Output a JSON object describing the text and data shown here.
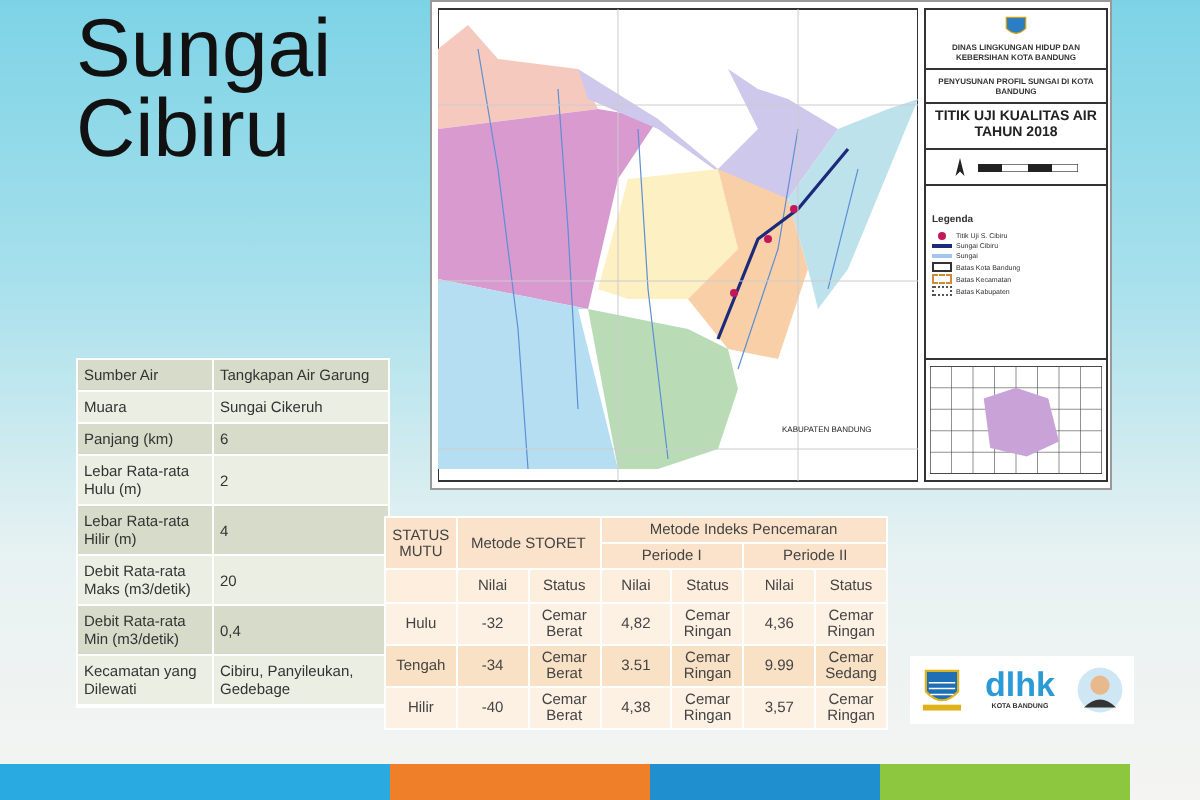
{
  "title": "Sungai Cibiru",
  "profile_table": [
    {
      "label": "Sumber Air",
      "value": "Tangkapan Air Garung"
    },
    {
      "label": "Muara",
      "value": "Sungai Cikeruh"
    },
    {
      "label": "Panjang (km)",
      "value": "6"
    },
    {
      "label": "Lebar Rata-rata Hulu (m)",
      "value": "2"
    },
    {
      "label": "Lebar Rata-rata Hilir (m)",
      "value": "4"
    },
    {
      "label": "Debit Rata-rata Maks (m3/detik)",
      "value": "20"
    },
    {
      "label": "Debit Rata-rata Min (m3/detik)",
      "value": "0,4"
    },
    {
      "label": "Kecamatan yang Dilewati",
      "value": "Cibiru, Panyileukan, Gedebage"
    }
  ],
  "map": {
    "agency": "DINAS LINGKUNGAN HIDUP DAN KEBERSIHAN KOTA BANDUNG",
    "project": "PENYUSUNAN PROFIL SUNGAI DI KOTA BANDUNG",
    "title": "TITIK UJI KUALITAS AIR TAHUN 2018",
    "area_label": "KABUPATEN BANDUNG",
    "legend_title": "Legenda",
    "legend": [
      {
        "kind": "point",
        "label": "Titik Uji S. Cibiru"
      },
      {
        "kind": "main-river",
        "label": "Sungai Cibiru"
      },
      {
        "kind": "river",
        "label": "Sungai"
      },
      {
        "kind": "city-border",
        "label": "Batas Kota Bandung"
      },
      {
        "kind": "district-border",
        "label": "Batas Kecamatan"
      },
      {
        "kind": "regency-border",
        "label": "Batas Kabupaten"
      }
    ]
  },
  "quality_table": {
    "status_heading": "STATUS MUTU",
    "storet_heading": "Metode STORET",
    "index_heading": "Metode Indeks Pencemaran",
    "periods": [
      "Periode I",
      "Periode II"
    ],
    "subheadings": [
      "Nilai",
      "Status",
      "Nilai",
      "Status",
      "Nilai",
      "Status"
    ],
    "rows": [
      {
        "label": "Hulu",
        "cells": [
          "-32",
          "Cemar Berat",
          "4,82",
          "Cemar Ringan",
          "4,36",
          "Cemar Ringan"
        ]
      },
      {
        "label": "Tengah",
        "cells": [
          "-34",
          "Cemar Berat",
          "3.51",
          "Cemar Ringan",
          "9.99",
          "Cemar Sedang"
        ]
      },
      {
        "label": "Hilir",
        "cells": [
          "-40",
          "Cemar Berat",
          "4,38",
          "Cemar Ringan",
          "3,57",
          "Cemar Ringan"
        ]
      }
    ]
  },
  "logos": {
    "dlhk": "dlhk",
    "city": "KOTA BANDUNG"
  },
  "footer_stripes": [
    {
      "color": "#29abe2"
    },
    {
      "color": "#f07f2a"
    },
    {
      "color": "#1f8fd0"
    },
    {
      "color": "#8dc63f"
    }
  ]
}
